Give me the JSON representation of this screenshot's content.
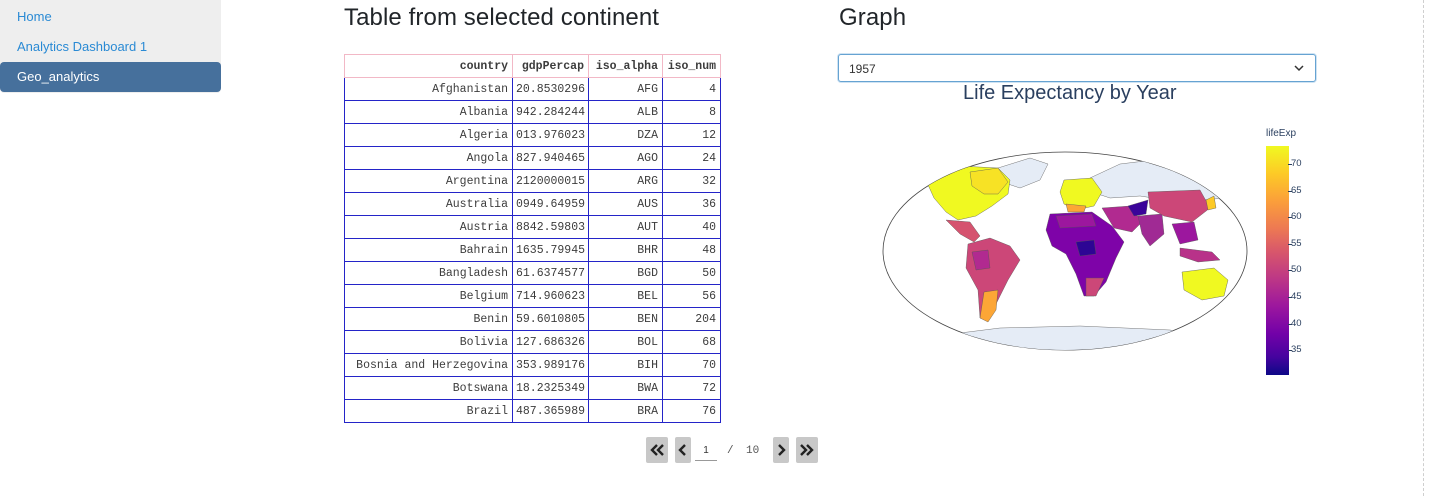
{
  "sidebar": {
    "items": [
      {
        "label": "Home",
        "active": false
      },
      {
        "label": "Analytics Dashboard 1",
        "active": false
      },
      {
        "label": "Geo_analytics",
        "active": true
      }
    ]
  },
  "table_section": {
    "title": "Table from selected continent",
    "columns": [
      "country",
      "gdpPercap",
      "iso_alpha",
      "iso_num"
    ],
    "rows": [
      [
        "Afghanistan",
        "20.8530296",
        "AFG",
        "4"
      ],
      [
        "Albania",
        "942.284244",
        "ALB",
        "8"
      ],
      [
        "Algeria",
        "013.976023",
        "DZA",
        "12"
      ],
      [
        "Angola",
        "827.940465",
        "AGO",
        "24"
      ],
      [
        "Argentina",
        "2120000015",
        "ARG",
        "32"
      ],
      [
        "Australia",
        "0949.64959",
        "AUS",
        "36"
      ],
      [
        "Austria",
        "8842.59803",
        "AUT",
        "40"
      ],
      [
        "Bahrain",
        "1635.79945",
        "BHR",
        "48"
      ],
      [
        "Bangladesh",
        "61.6374577",
        "BGD",
        "50"
      ],
      [
        "Belgium",
        "714.960623",
        "BEL",
        "56"
      ],
      [
        "Benin",
        "59.6010805",
        "BEN",
        "204"
      ],
      [
        "Bolivia",
        "127.686326",
        "BOL",
        "68"
      ],
      [
        "Bosnia and Herzegovina",
        "353.989176",
        "BIH",
        "70"
      ],
      [
        "Botswana",
        "18.2325349",
        "BWA",
        "72"
      ],
      [
        "Brazil",
        "487.365989",
        "BRA",
        "76"
      ]
    ]
  },
  "pagination": {
    "current_page": "1",
    "separator": "/",
    "total_pages": "10",
    "icons": [
      "double-chevron-left-icon",
      "chevron-left-icon",
      "chevron-right-icon",
      "double-chevron-right-icon"
    ]
  },
  "graph_section": {
    "title": "Graph",
    "year_dropdown": {
      "selected": "1957"
    },
    "chart_title": "Life Expectancy by Year",
    "colorbar_title": "lifeExp",
    "colorbar_ticks": [
      "70",
      "65",
      "60",
      "55",
      "50",
      "45",
      "40",
      "35"
    ],
    "colorscale": "plasma",
    "colors": {
      "land_no_data": "#e5ecf6",
      "title": "#2a3f5f",
      "dropdown_border": "#66a3d2"
    }
  },
  "colors": {
    "sidebar_bg": "#eeeeee",
    "sidebar_active_bg": "#46709c",
    "link": "#2a8ad4",
    "table_cell_border": "#2424c8",
    "table_header_border": "#f2b8c6",
    "pager_button": "#c8c8c8"
  }
}
